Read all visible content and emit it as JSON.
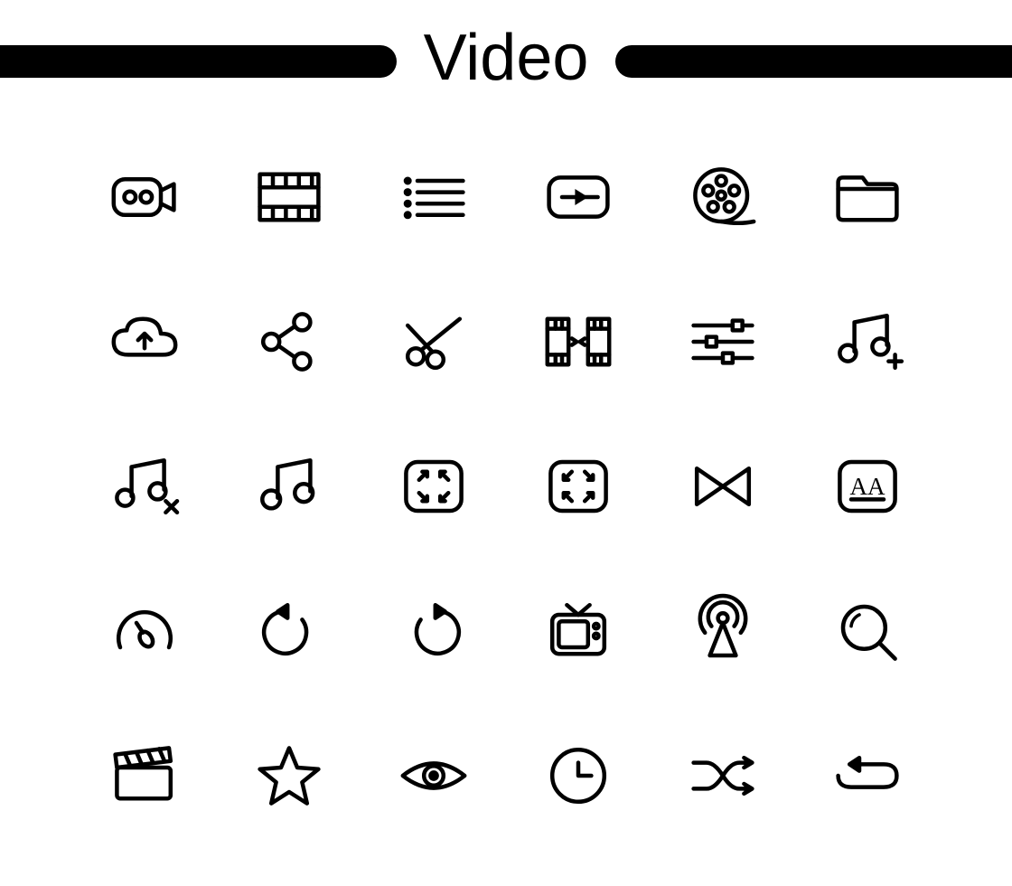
{
  "header": {
    "title": "Video"
  },
  "icons": [
    {
      "name": "video-camera-icon"
    },
    {
      "name": "film-strip-icon"
    },
    {
      "name": "list-icon"
    },
    {
      "name": "play-video-icon"
    },
    {
      "name": "film-reel-icon"
    },
    {
      "name": "folder-icon"
    },
    {
      "name": "cloud-upload-icon"
    },
    {
      "name": "share-icon"
    },
    {
      "name": "scissors-icon"
    },
    {
      "name": "film-merge-icon"
    },
    {
      "name": "sliders-icon"
    },
    {
      "name": "music-add-icon"
    },
    {
      "name": "music-remove-icon"
    },
    {
      "name": "music-note-icon"
    },
    {
      "name": "fullscreen-expand-icon"
    },
    {
      "name": "fullscreen-collapse-icon"
    },
    {
      "name": "bowtie-icon"
    },
    {
      "name": "font-size-icon"
    },
    {
      "name": "speedometer-icon"
    },
    {
      "name": "undo-icon"
    },
    {
      "name": "redo-icon"
    },
    {
      "name": "television-icon"
    },
    {
      "name": "broadcast-antenna-icon"
    },
    {
      "name": "search-icon"
    },
    {
      "name": "clapperboard-icon"
    },
    {
      "name": "star-icon"
    },
    {
      "name": "eye-icon"
    },
    {
      "name": "clock-icon"
    },
    {
      "name": "shuffle-icon"
    },
    {
      "name": "loop-icon"
    }
  ],
  "font_label": "AA"
}
